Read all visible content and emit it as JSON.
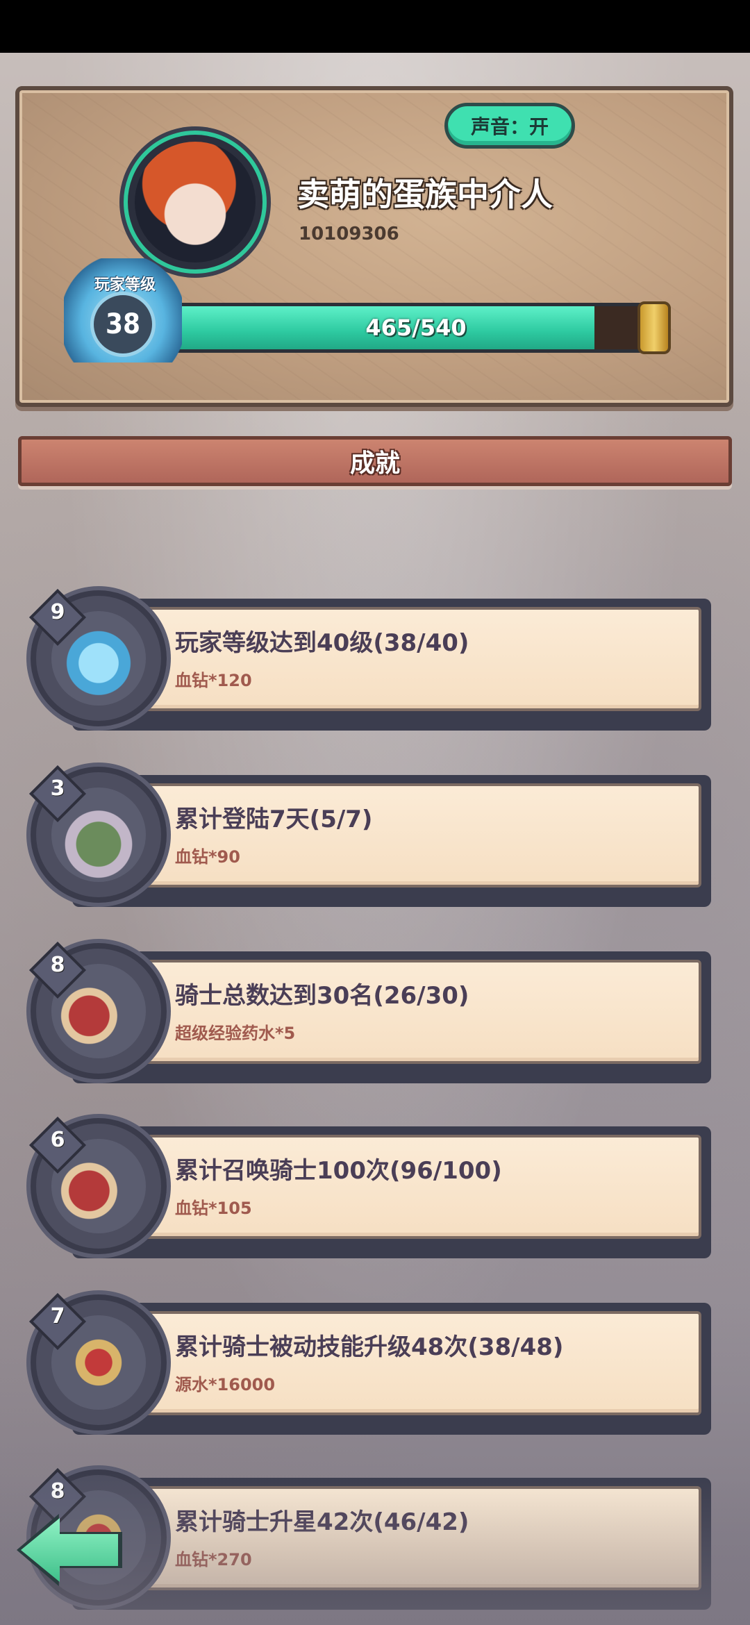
{
  "header": {
    "sound_label": "声音：开",
    "player_name": "卖萌的蛋族中介人",
    "player_id": "10109306",
    "level_label": "玩家等级",
    "level": "38",
    "xp_text": "465/540",
    "xp_progress": 0.861
  },
  "section": {
    "title": "成就"
  },
  "achievements": [
    {
      "badge": "9",
      "icon": "blue-flame-icon",
      "title": "玩家等级达到40级(38/40)",
      "reward": "血钻*120"
    },
    {
      "badge": "3",
      "icon": "gear-helmet-icon",
      "title": "累计登陆7天(5/7)",
      "reward": "血钻*90"
    },
    {
      "badge": "8",
      "icon": "knights-group-icon",
      "title": "骑士总数达到30名(26/30)",
      "reward": "超级经验药水*5"
    },
    {
      "badge": "6",
      "icon": "knights-group-icon",
      "title": "累计召唤骑士100次(96/100)",
      "reward": "血钻*105"
    },
    {
      "badge": "7",
      "icon": "straw-hat-knight-icon",
      "title": "累计骑士被动技能升级48次(38/48)",
      "reward": "源水*16000"
    },
    {
      "badge": "8",
      "icon": "straw-hat-knight-icon",
      "title": "累计骑士升星42次(46/42)",
      "reward": "血钻*270"
    }
  ],
  "colors": {
    "accent": "#3fe0b0",
    "header_bar": "#b0665a",
    "card": "#f6dfc3",
    "reward_text": "#a05a4e"
  }
}
